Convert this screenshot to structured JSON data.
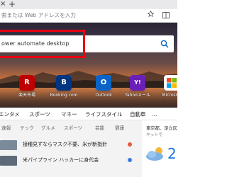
{
  "browser": {
    "tab_close_glyph": "×",
    "new_tab_glyph": "+",
    "address_placeholder": "索または Web アドレスを入力"
  },
  "search": {
    "value": "ower automate desktop"
  },
  "quick_links": [
    {
      "label": "楽天市場",
      "glyph": "R",
      "color": "#bf0000"
    },
    {
      "label": "Booking.com",
      "glyph": "B",
      "color": "#003580"
    },
    {
      "label": "Outlook",
      "glyph": "O",
      "color": "#0a64c8"
    },
    {
      "label": "Yahooメール",
      "glyph": "Y!",
      "color": "#6a1fb8"
    },
    {
      "label": "Microsoft",
      "glyph": "",
      "color": "#ffffff"
    }
  ],
  "categories": [
    "エンタメ",
    "スポーツ",
    "マネー",
    "ライフスタイル",
    "自動車",
    "…"
  ],
  "subcategories": [
    "速報",
    "テック",
    "グルメ",
    "スポーツ",
    "芸能",
    "健康"
  ],
  "news": [
    {
      "title": "接種見ずならマスク不要、米が新指針"
    },
    {
      "title": "米パイプライン ハッカーに身代金"
    }
  ],
  "weather": {
    "location": "東京都、足立区",
    "sub": "ネットで",
    "temp": "2"
  }
}
